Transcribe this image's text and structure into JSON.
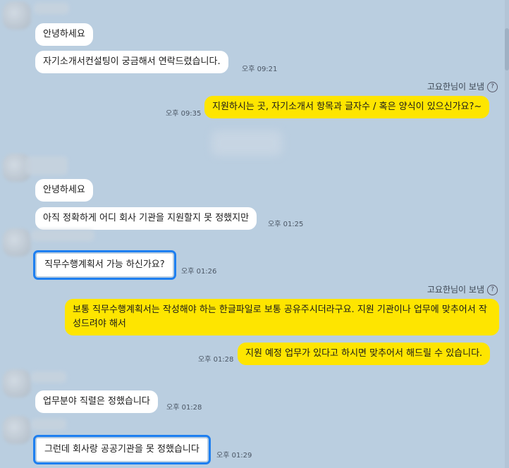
{
  "messages": {
    "m1": {
      "text": "안녕하세요"
    },
    "m2": {
      "text": "자기소개서컨설팅이 궁금해서 연락드렸습니다.",
      "time": "오후 09:21"
    },
    "s1": {
      "sender": "고요한님이 보냄",
      "help": "?"
    },
    "m3": {
      "text": "지원하시는 곳, 자기소개서 항목과 글자수 / 혹은 양식이 있으신가요?~",
      "time": "오후 09:35"
    },
    "m4": {
      "text": "안녕하세요"
    },
    "m5": {
      "text": "아직 정확하게 어디 회사 기관을 지원할지 못 정했지만",
      "time": "오후 01:25"
    },
    "m6": {
      "text": "직무수행계획서 가능 하신가요?",
      "time": "오후 01:26"
    },
    "s2": {
      "sender": "고요한님이 보냄",
      "help": "?"
    },
    "m7": {
      "text": "보통 직무수행계획서는 작성해야 하는 한글파일로 보통 공유주시더라구요. 지원 기관이나 업무에 맞추어서 작성드려야 해서"
    },
    "m8": {
      "text": "지원 예정 업무가 있다고 하시면 맞추어서 해드릴 수 있습니다.",
      "time": "오후 01:28"
    },
    "m9": {
      "text": "업무분야 직렬은 정했습니다",
      "time": "오후 01:28"
    },
    "m10": {
      "text": "그런데 회사랑 공공기관을 못 정했습니다",
      "time": "오후 01:29"
    }
  },
  "colors": {
    "background": "#bacee0",
    "incoming_bubble": "#ffffff",
    "outgoing_bubble": "#fee500",
    "highlight": "#1e7ff0"
  }
}
